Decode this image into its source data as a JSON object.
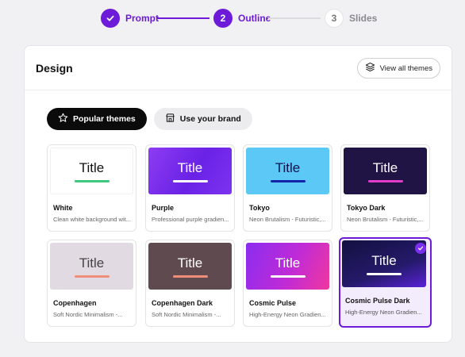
{
  "stepper": {
    "steps": [
      {
        "label": "Prompt",
        "marker": "check-icon",
        "status": "done"
      },
      {
        "label": "Outline",
        "marker": "2",
        "status": "active"
      },
      {
        "label": "Slides",
        "marker": "3",
        "status": "todo"
      }
    ]
  },
  "panel": {
    "title": "Design",
    "view_all_label": "View all themes",
    "tabs": [
      {
        "label": "Popular themes",
        "icon": "star-icon",
        "active": true
      },
      {
        "label": "Use your brand",
        "icon": "store-icon",
        "active": false
      }
    ]
  },
  "themes": [
    {
      "name": "White",
      "description": "Clean white background wit...",
      "thumb_title": "Title",
      "bg": "#ffffff",
      "title_color": "#111111",
      "bar_color": "#3fc97f"
    },
    {
      "name": "Purple",
      "description": "Professional purple gradien...",
      "thumb_title": "Title",
      "bg": "#7a2ff0",
      "title_color": "#ffffff",
      "bar_color": "#ffffff"
    },
    {
      "name": "Tokyo",
      "description": "Neon Brutalism - Futuristic,...",
      "thumb_title": "Title",
      "bg": "#5bc8f5",
      "title_color": "#0b1550",
      "bar_color": "#1424a8"
    },
    {
      "name": "Tokyo Dark",
      "description": "Neon Brutalism - Futuristic,...",
      "thumb_title": "Title",
      "bg": "#1f1444",
      "title_color": "#ffffff",
      "bar_color": "#e23cc8"
    },
    {
      "name": "Copenhagen",
      "description": "Soft Nordic Minimalism -...",
      "thumb_title": "Title",
      "bg": "#e2dae2",
      "title_color": "#444444",
      "bar_color": "#ee8e78"
    },
    {
      "name": "Copenhagen Dark",
      "description": "Soft Nordic Minimalism -...",
      "thumb_title": "Title",
      "bg": "#5f4a50",
      "title_color": "#ffffff",
      "bar_color": "#ee8e78"
    },
    {
      "name": "Cosmic Pulse",
      "description": "High-Energy Neon Gradien...",
      "thumb_title": "Title",
      "bg": "#b32ad8",
      "title_color": "#ffffff",
      "bar_color": "#ffffff"
    },
    {
      "name": "Cosmic Pulse Dark",
      "description": "High-Energy Neon Gradien...",
      "thumb_title": "Title",
      "bg": "#1a1248",
      "title_color": "#ffffff",
      "bar_color": "#ffffff",
      "selected": true
    }
  ],
  "colors": {
    "accent": "#6d1bd9"
  }
}
